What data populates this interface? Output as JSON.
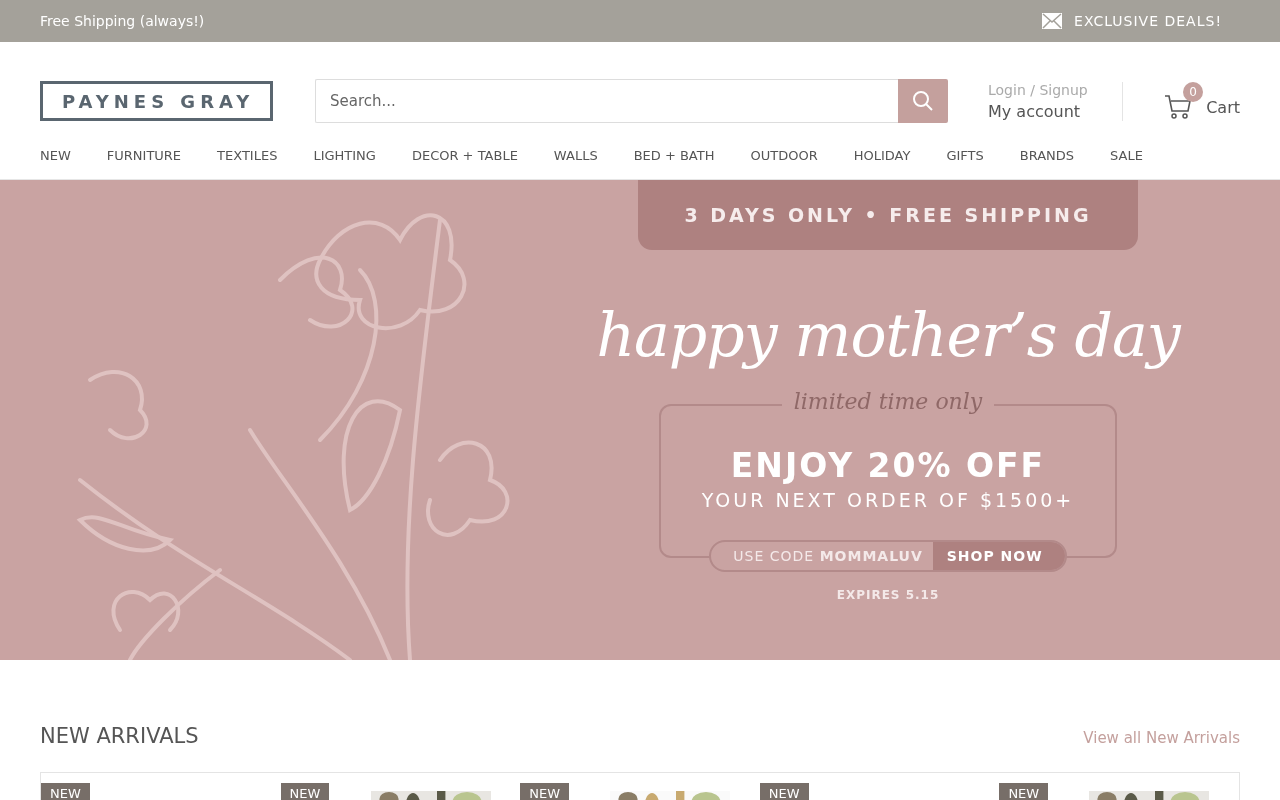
{
  "announcement_bar": {
    "left_text": "Free Shipping (always!)",
    "right_text": "EXCLUSIVE DEALS!"
  },
  "header": {
    "logo": "PAYNES GRAY",
    "search": {
      "placeholder": "Search..."
    },
    "account": {
      "login_link": "Login / Signup",
      "account_link": "My account"
    },
    "cart": {
      "count": "0",
      "label": "Cart"
    }
  },
  "nav": {
    "items": [
      "NEW",
      "FURNITURE",
      "TEXTILES",
      "LIGHTING",
      "DECOR + TABLE",
      "WALLS",
      "BED + BATH",
      "OUTDOOR",
      "HOLIDAY",
      "GIFTS",
      "BRANDS",
      "SALE"
    ]
  },
  "hero_banner": {
    "top_tab": "3 DAYS ONLY •  FREE SHIPPING",
    "headline": "happy mother’s day",
    "subheading": "limited time only",
    "offer": "ENJOY 20% OFF",
    "offer_detail": "YOUR NEXT ORDER OF $1500+",
    "code_label": "USE CODE **MOMMALUV**",
    "cta": "SHOP NOW",
    "expiry": "EXPIRES 5.15"
  },
  "new_arrivals": {
    "title": "NEW ARRIVALS",
    "view_all_link": "View all New Arrivals",
    "products": [
      {
        "badge": "NEW"
      },
      {
        "badge": "NEW",
        "kind": "picture"
      },
      {
        "badge": "NEW",
        "kind": "picture"
      },
      {
        "badge": "NEW"
      },
      {
        "badge": "NEW",
        "kind": "picture"
      }
    ]
  }
}
